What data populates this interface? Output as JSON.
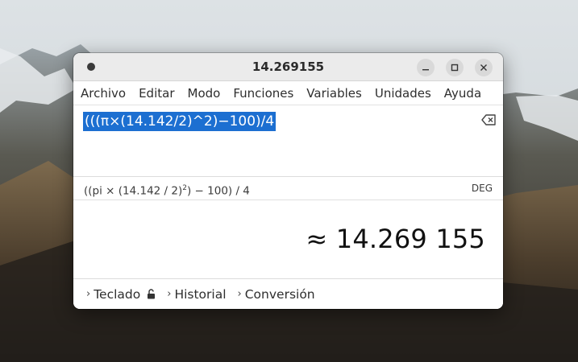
{
  "window": {
    "title": "14.269155"
  },
  "menubar": {
    "items": [
      "Archivo",
      "Editar",
      "Modo",
      "Funciones",
      "Variables",
      "Unidades",
      "Ayuda"
    ]
  },
  "expression": {
    "value": "(((π×(14.142/2)^2)−100)/4"
  },
  "parsed": {
    "before": "((pi × (14.142 / 2)",
    "exponent": "2",
    "after": ") − 100) / 4",
    "angle_mode": "DEG"
  },
  "result": {
    "value": "≈ 14.269 155"
  },
  "bottom": {
    "keypad_label": "Teclado",
    "history_label": "Historial",
    "conversion_label": "Conversión"
  },
  "icons": {
    "app": "app-menu-dot-icon",
    "minimize": "minimize-icon",
    "maximize": "maximize-icon",
    "close": "close-icon",
    "backspace": "backspace-icon",
    "lock": "lock-icon",
    "chevron": "chevron-right-icon"
  },
  "colors": {
    "selection": "#1c6fd1",
    "titlebar": "#ebebeb"
  }
}
